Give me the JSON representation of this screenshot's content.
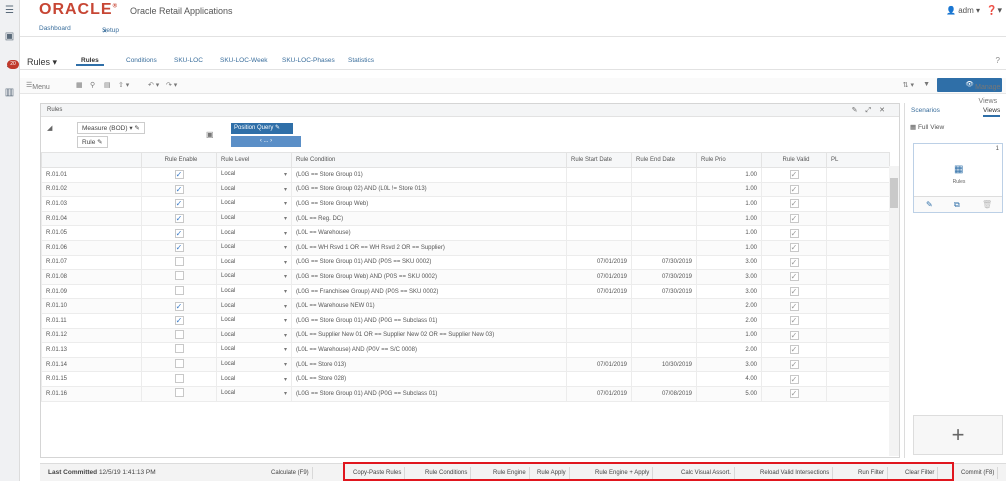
{
  "app": {
    "brand": "ORACLE",
    "title": "Oracle Retail Applications",
    "user": "adm",
    "notifications": "20"
  },
  "nav_tabs": [
    "Dashboard",
    "Setup"
  ],
  "subnav": {
    "rules_dd": "Rules",
    "tabs": [
      "Rules",
      "Conditions",
      "SKU-LOC",
      "SKU-LOC-Week",
      "SKU-LOC-Phases",
      "Statistics"
    ]
  },
  "toolbar": {
    "menu": "Menu",
    "manage_views": "Manage Views"
  },
  "panel": {
    "title": "Rules",
    "measure": "Measure (BOD)",
    "rule": "Rule",
    "position_query": "Position Query",
    "nav": "..."
  },
  "grid": {
    "headers": [
      "",
      "Rule Enable",
      "Rule Level",
      "Rule Condition",
      "Rule Start Date",
      "Rule End Date",
      "Rule Prio",
      "Rule Valid",
      "PL"
    ],
    "rows": [
      {
        "id": "R.01.01",
        "enable": true,
        "level": "Local",
        "cond": "(L0G == Store Group 01)",
        "start": "",
        "end": "",
        "prio": "1.00"
      },
      {
        "id": "R.01.02",
        "enable": true,
        "level": "Local",
        "cond": "(L0G == Store Group 02) AND (L0L != Store 013)",
        "start": "",
        "end": "",
        "prio": "1.00"
      },
      {
        "id": "R.01.03",
        "enable": true,
        "level": "Local",
        "cond": "(L0G == Store Group Web)",
        "start": "",
        "end": "",
        "prio": "1.00"
      },
      {
        "id": "R.01.04",
        "enable": true,
        "level": "Local",
        "cond": "(L0L == Reg. DC)",
        "start": "",
        "end": "",
        "prio": "1.00"
      },
      {
        "id": "R.01.05",
        "enable": true,
        "level": "Local",
        "cond": "(L0L == Warehouse)",
        "start": "",
        "end": "",
        "prio": "1.00"
      },
      {
        "id": "R.01.06",
        "enable": true,
        "level": "Local",
        "cond": "(L0L == WH Rsvd 1 OR == WH Rsvd 2 OR == Supplier)",
        "start": "",
        "end": "",
        "prio": "1.00"
      },
      {
        "id": "R.01.07",
        "enable": false,
        "level": "Local",
        "cond": "(L0G == Store Group 01) AND (P0S == SKU 0002)",
        "start": "07/01/2019",
        "end": "07/30/2019",
        "prio": "3.00"
      },
      {
        "id": "R.01.08",
        "enable": false,
        "level": "Local",
        "cond": "(L0G == Store Group Web) AND (P0S == SKU 0002)",
        "start": "07/01/2019",
        "end": "07/30/2019",
        "prio": "3.00"
      },
      {
        "id": "R.01.09",
        "enable": false,
        "level": "Local",
        "cond": "(L0G == Franchisee Group) AND (P0S == SKU 0002)",
        "start": "07/01/2019",
        "end": "07/30/2019",
        "prio": "3.00"
      },
      {
        "id": "R.01.10",
        "enable": true,
        "level": "Local",
        "cond": "(L0L == Warehouse NEW 01)",
        "start": "",
        "end": "",
        "prio": "2.00"
      },
      {
        "id": "R.01.11",
        "enable": true,
        "level": "Local",
        "cond": "(L0G == Store Group 01) AND (P0G == Subclass 01)",
        "start": "",
        "end": "",
        "prio": "2.00"
      },
      {
        "id": "R.01.12",
        "enable": false,
        "level": "Local",
        "cond": "(L0L == Supplier New 01 OR == Supplier New 02 OR == Supplier New 03)",
        "start": "",
        "end": "",
        "prio": "1.00"
      },
      {
        "id": "R.01.13",
        "enable": false,
        "level": "Local",
        "cond": "(L0L == Warehouse) AND (P0V == S/C 0008)",
        "start": "",
        "end": "",
        "prio": "2.00"
      },
      {
        "id": "R.01.14",
        "enable": false,
        "level": "Local",
        "cond": "(L0L == Store 013)",
        "start": "07/01/2019",
        "end": "10/30/2019",
        "prio": "3.00"
      },
      {
        "id": "R.01.15",
        "enable": false,
        "level": "Local",
        "cond": "(L0L == Store 028)",
        "start": "",
        "end": "",
        "prio": "4.00"
      },
      {
        "id": "R.01.16",
        "enable": false,
        "level": "Local",
        "cond": "(L0G == Store Group 01) AND (P0G == Subclass 01)",
        "start": "07/01/2019",
        "end": "07/08/2019",
        "prio": "5.00"
      }
    ]
  },
  "right_panel": {
    "scenarios": "Scenarios",
    "views": "Views",
    "full_view": "Full View",
    "card_caption": "Rules",
    "card_num": "1"
  },
  "status": {
    "last_committed_label": "Last Committed",
    "last_committed_value": "12/5/19 1:41:13 PM",
    "buttons": [
      "Calculate (F9)",
      "Copy-Paste Rules",
      "Rule Conditions",
      "Rule Engine",
      "Rule Apply",
      "Rule Engine + Apply",
      "Calc Visual Assort.",
      "Reload Valid Intersections",
      "Run Filter",
      "Clear Filter",
      "Commit (F8)"
    ]
  }
}
